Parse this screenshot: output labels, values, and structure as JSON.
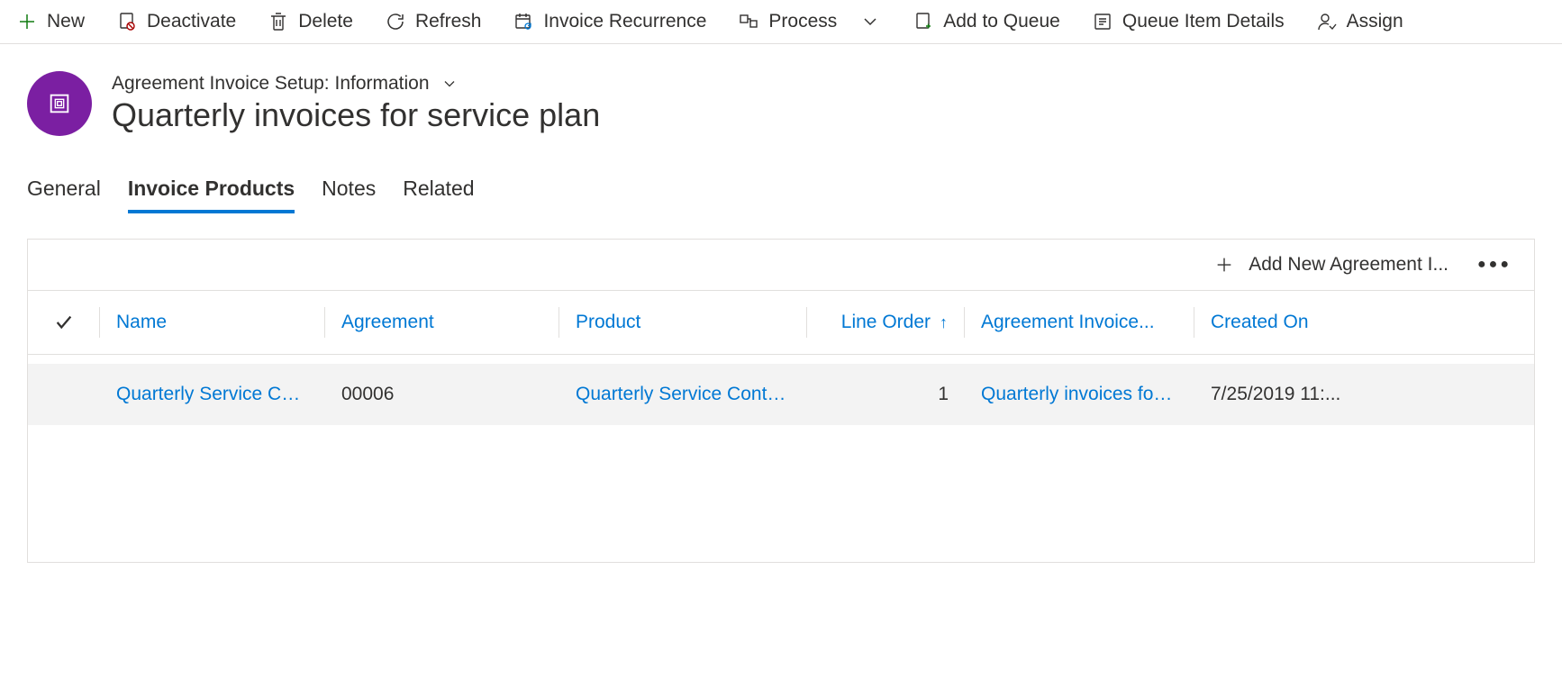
{
  "toolbar": {
    "new": "New",
    "deactivate": "Deactivate",
    "delete": "Delete",
    "refresh": "Refresh",
    "invoice_recurrence": "Invoice Recurrence",
    "process": "Process",
    "add_to_queue": "Add to Queue",
    "queue_item_details": "Queue Item Details",
    "assign": "Assign"
  },
  "entity": {
    "type_label": "Agreement Invoice Setup: Information",
    "name": "Quarterly invoices for service plan"
  },
  "tabs": {
    "general": "General",
    "invoice_products": "Invoice Products",
    "notes": "Notes",
    "related": "Related"
  },
  "grid": {
    "add_new_label": "Add New Agreement I...",
    "columns": {
      "name": "Name",
      "agreement": "Agreement",
      "product": "Product",
      "line_order": "Line Order",
      "agreement_invoice": "Agreement Invoice...",
      "created_on": "Created On"
    },
    "rows": [
      {
        "name": "Quarterly Service Contract.",
        "agreement": "00006",
        "product": "Quarterly Service Contract.",
        "line_order": "1",
        "agreement_invoice": "Quarterly invoices for servi",
        "created_on": "7/25/2019 11:..."
      }
    ]
  }
}
